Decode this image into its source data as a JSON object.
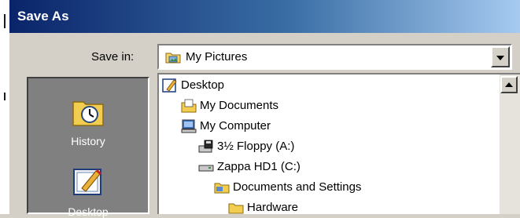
{
  "window": {
    "title": "Save As"
  },
  "save_in": {
    "label": "Save in:",
    "value": "My Pictures"
  },
  "places": [
    {
      "label": "History",
      "icon": "history-icon"
    },
    {
      "label": "Desktop",
      "icon": "desktop-icon"
    }
  ],
  "tree": {
    "items": [
      {
        "label": "Desktop",
        "icon": "desktop-icon"
      },
      {
        "label": "My Documents",
        "icon": "my-documents-icon"
      },
      {
        "label": "My Computer",
        "icon": "my-computer-icon"
      },
      {
        "label": "3½ Floppy (A:)",
        "icon": "floppy-drive-icon"
      },
      {
        "label": "Zappa HD1 (C:)",
        "icon": "hard-drive-icon"
      },
      {
        "label": "Documents and Settings",
        "icon": "folder-icon"
      },
      {
        "label": "Hardware",
        "icon": "folder-icon"
      }
    ]
  },
  "colors": {
    "titlebar_start": "#0a246a",
    "titlebar_end": "#a6caf0",
    "places_bg": "#808080"
  }
}
